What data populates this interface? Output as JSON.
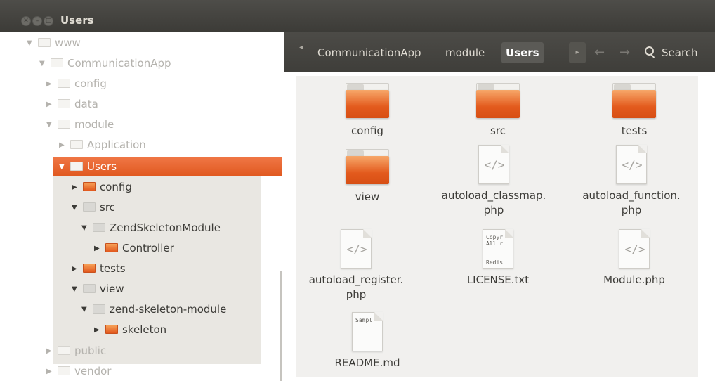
{
  "window": {
    "title": "Users"
  },
  "breadcrumb": {
    "items": [
      "CommunicationApp",
      "module",
      "Users"
    ],
    "active_index": 2
  },
  "toolbar": {
    "search_label": "Search"
  },
  "sidebar": {
    "rows": [
      {
        "label": "www",
        "expanded": true
      },
      {
        "label": "CommunicationApp",
        "expanded": true
      },
      {
        "label": "config",
        "expanded": false
      },
      {
        "label": "data",
        "expanded": false
      },
      {
        "label": "module",
        "expanded": true
      },
      {
        "label": "Application",
        "expanded": false
      },
      {
        "label": "Users",
        "expanded": true,
        "selected": true
      },
      {
        "label": "config",
        "expanded": false
      },
      {
        "label": "src",
        "expanded": true
      },
      {
        "label": "ZendSkeletonModule",
        "expanded": true
      },
      {
        "label": "Controller",
        "expanded": false
      },
      {
        "label": "tests",
        "expanded": false
      },
      {
        "label": "view",
        "expanded": true
      },
      {
        "label": "zend-skeleton-module",
        "expanded": true
      },
      {
        "label": "skeleton",
        "expanded": false
      },
      {
        "label": "public",
        "expanded": false
      },
      {
        "label": "vendor",
        "expanded": false
      }
    ]
  },
  "files": [
    {
      "name_line1": "config",
      "name_line2": "",
      "type": "folder"
    },
    {
      "name_line1": "src",
      "name_line2": "",
      "type": "folder"
    },
    {
      "name_line1": "tests",
      "name_line2": "",
      "type": "folder"
    },
    {
      "name_line1": "view",
      "name_line2": "",
      "type": "folder"
    },
    {
      "name_line1": "autoload_classmap.",
      "name_line2": "php",
      "type": "php"
    },
    {
      "name_line1": "autoload_function.",
      "name_line2": "php",
      "type": "php"
    },
    {
      "name_line1": "autoload_register.",
      "name_line2": "php",
      "type": "php"
    },
    {
      "name_line1": "LICENSE.txt",
      "name_line2": "",
      "type": "text",
      "preview": [
        "Copyr",
        "All r",
        "",
        "Redis"
      ]
    },
    {
      "name_line1": "Module.php",
      "name_line2": "",
      "type": "php"
    },
    {
      "name_line1": "README.md",
      "name_line2": "",
      "type": "text",
      "preview": [
        "Sampl"
      ]
    }
  ],
  "colors": {
    "accent": "#e95420",
    "titlebar": "#3c3b37",
    "content_bg": "#f1f0ee"
  }
}
